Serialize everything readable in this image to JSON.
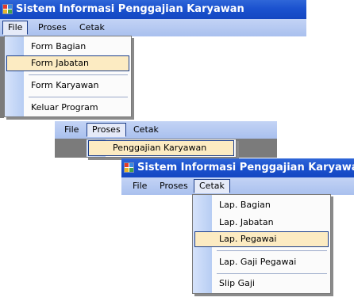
{
  "app": {
    "title": "Sistem Informasi Penggajian Karyawan"
  },
  "menus": {
    "file": "File",
    "proses": "Proses",
    "cetak": "Cetak"
  },
  "file_menu": {
    "items": [
      "Form Bagian",
      "Form Jabatan",
      "Form Karyawan",
      "Keluar Program"
    ],
    "highlighted": "Form Jabatan"
  },
  "proses_menu": {
    "items": [
      "Penggajian Karyawan"
    ],
    "highlighted": "Penggajian Karyawan"
  },
  "cetak_menu": {
    "items": [
      "Lap. Bagian",
      "Lap. Jabatan",
      "Lap. Pegawai",
      "Lap. Gaji Pegawai",
      "Slip Gaji"
    ],
    "highlighted": "Lap. Pegawai"
  },
  "colors": {
    "titlebar": "#1b52cf",
    "menubar": "#b4c8f1",
    "highlight_fill": "#fcebc2",
    "highlight_border": "#1c3e8a"
  }
}
